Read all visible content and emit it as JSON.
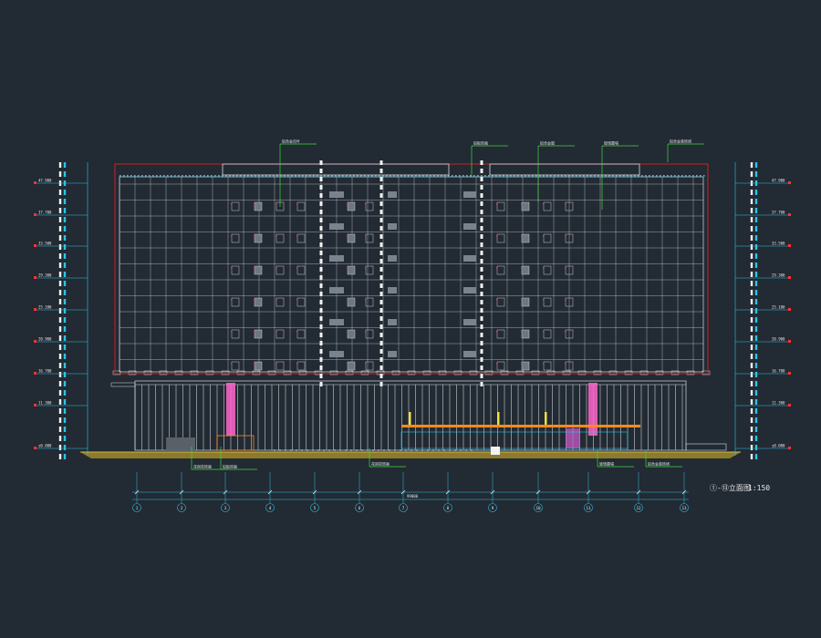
{
  "colors": {
    "background": "#222a33",
    "grid": "#d9dde2",
    "outline": "#cc2222",
    "leader": "#3ddc3d",
    "dimension": "#2ec4e6",
    "column_stripe": "#ff66cc",
    "canopy": "#ff8c1a",
    "ground": "#a08a2a",
    "level_marker": "#ff3333"
  },
  "drawing": {
    "title": "①-⑬立面图",
    "scale": "1:150",
    "axis_labels": [
      "1",
      "2",
      "3",
      "4",
      "5",
      "6",
      "7",
      "8",
      "9",
      "10",
      "11",
      "12",
      "13"
    ]
  },
  "levels": {
    "left": [
      "47.900",
      "37.700",
      "33.500",
      "29.300",
      "25.100",
      "20.900",
      "16.700",
      "11.300",
      "±0.000"
    ],
    "right": [
      "47.900",
      "37.700",
      "33.500",
      "29.300",
      "25.100",
      "20.900",
      "16.700",
      "11.300",
      "±0.000"
    ]
  },
  "callouts": {
    "top": [
      "铝合金百叶",
      "铝板饰面",
      "铝合金窗",
      "玻璃幕墙",
      "铝合金装饰线"
    ],
    "bottom": [
      "花岗岩饰面",
      "铝板饰面",
      "花岗岩饰面",
      "玻璃幕墙",
      "铝合金装饰线"
    ]
  },
  "dimensions": {
    "total": "99000"
  }
}
